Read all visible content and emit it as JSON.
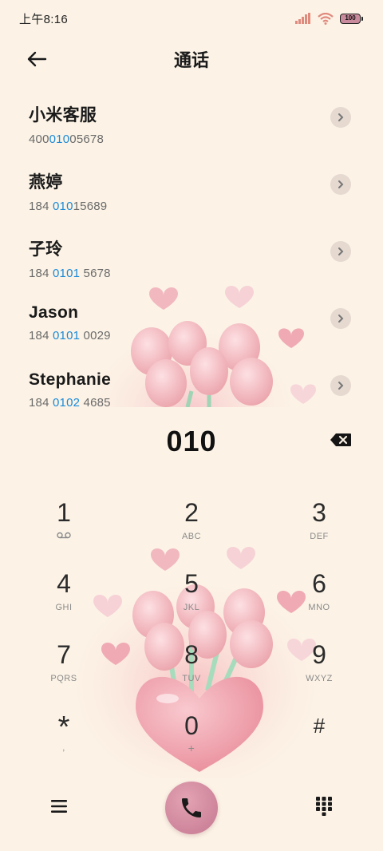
{
  "status_bar": {
    "time": "上午8:16",
    "battery": "100",
    "icons": [
      "signal-icon",
      "wifi-icon",
      "battery-icon"
    ]
  },
  "header": {
    "title": "通话",
    "back_icon": "arrow-left-icon"
  },
  "results": [
    {
      "name": "小米客服",
      "number_parts": [
        "400",
        "010",
        "05678"
      ]
    },
    {
      "name": "燕婷",
      "number_parts": [
        "184 ",
        "010",
        "15689"
      ]
    },
    {
      "name": "子玲",
      "number_parts": [
        "184 ",
        "0101",
        " 5678"
      ]
    },
    {
      "name": "Jason",
      "number_parts": [
        "184 ",
        "0101",
        " 0029"
      ]
    },
    {
      "name": "Stephanie",
      "number_parts": [
        "184 ",
        "0102",
        " 4685"
      ]
    }
  ],
  "dialer": {
    "digits": "010",
    "backspace_icon": "backspace-icon"
  },
  "keypad": [
    {
      "digit": "1",
      "letters": "",
      "icon": "voicemail-icon"
    },
    {
      "digit": "2",
      "letters": "ABC"
    },
    {
      "digit": "3",
      "letters": "DEF"
    },
    {
      "digit": "4",
      "letters": "GHI"
    },
    {
      "digit": "5",
      "letters": "JKL"
    },
    {
      "digit": "6",
      "letters": "MNO"
    },
    {
      "digit": "7",
      "letters": "PQRS"
    },
    {
      "digit": "8",
      "letters": "TUV"
    },
    {
      "digit": "9",
      "letters": "WXYZ"
    },
    {
      "digit": "*",
      "letters": ","
    },
    {
      "digit": "0",
      "letters": "+"
    },
    {
      "digit": "#",
      "letters": ""
    }
  ],
  "bottom_bar": {
    "menu_icon": "hamburger-menu-icon",
    "call_icon": "phone-icon",
    "dialpad_icon": "dialpad-icon"
  },
  "colors": {
    "background": "#fcf3e6",
    "highlight": "#1a8ad8",
    "call_button": "#c57891"
  }
}
